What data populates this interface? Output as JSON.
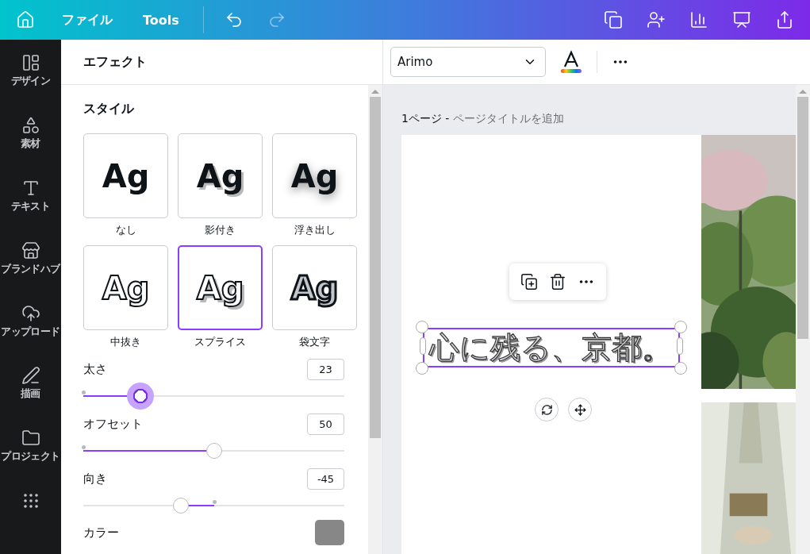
{
  "topbar": {
    "menu": [
      "ファイル",
      "Tools"
    ],
    "undo_disabled": false,
    "redo_disabled": true
  },
  "sidebar": {
    "items": [
      "デザイン",
      "素材",
      "テキスト",
      "ブランドハブ",
      "アップロード",
      "描画",
      "プロジェクト"
    ]
  },
  "panel": {
    "title": "エフェクト",
    "section": "スタイル",
    "styles": [
      {
        "kind": "none",
        "preview": "Ag",
        "label": "なし",
        "selected": false
      },
      {
        "kind": "shadow",
        "preview": "Ag",
        "label": "影付き",
        "selected": false
      },
      {
        "kind": "lift",
        "preview": "Ag",
        "label": "浮き出し",
        "selected": false
      },
      {
        "kind": "hollow",
        "preview": "Ag",
        "label": "中抜き",
        "selected": false
      },
      {
        "kind": "splice",
        "preview": "Ag",
        "label": "スプライス",
        "selected": true
      },
      {
        "kind": "outline",
        "preview": "Ag",
        "label": "袋文字",
        "selected": false
      }
    ],
    "sliders": [
      {
        "label": "太さ",
        "value": "23",
        "level": 0.22,
        "kind": "standard",
        "active": true
      },
      {
        "label": "オフセット",
        "value": "50",
        "level": 0.5,
        "kind": "standard",
        "active": false
      },
      {
        "label": "向き",
        "value": "-45",
        "level": 0.375,
        "kind": "bipolar",
        "active": false
      }
    ],
    "color": {
      "label": "カラー",
      "color": "#878787"
    }
  },
  "toolbar": {
    "font": "Arimo"
  },
  "canvas": {
    "page_number": "1ページ -",
    "page_title_placeholder": "ページタイトルを追加",
    "text": "心に残る、京都。"
  }
}
